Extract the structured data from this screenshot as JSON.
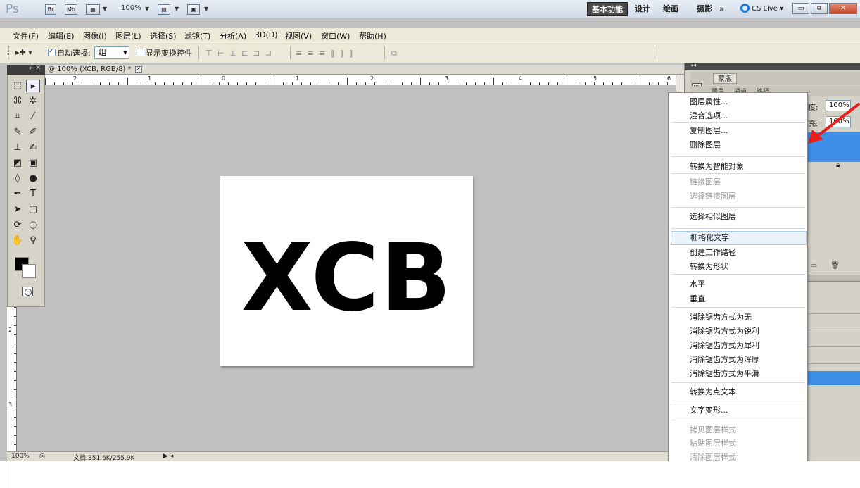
{
  "appbar": {
    "logo": "Ps",
    "bridge_label": "Br",
    "minibridge_label": "Mb",
    "zoom_value": "100%",
    "workspaces": [
      "基本功能",
      "设计",
      "绘画",
      "摄影",
      "»"
    ],
    "cslive_label": "CS Live"
  },
  "menubar": {
    "items": [
      "文件(F)",
      "编辑(E)",
      "图像(I)",
      "图层(L)",
      "选择(S)",
      "滤镜(T)",
      "分析(A)",
      "3D(D)",
      "视图(V)",
      "窗口(W)",
      "帮助(H)"
    ]
  },
  "options": {
    "auto_select_label": "自动选择:",
    "auto_select_checked": true,
    "auto_select_value": "组",
    "show_transform_label": "显示变换控件",
    "show_transform_checked": false
  },
  "document": {
    "tab_title": "@ 100% (XCB, RGB/8) *",
    "canvas_text": "XCB"
  },
  "rulers": {
    "h_labels": [
      "2",
      "1",
      "0",
      "1",
      "2",
      "3",
      "4",
      "5",
      "6"
    ],
    "v_labels": [
      "2",
      "3"
    ]
  },
  "statusbar": {
    "zoom": "100%",
    "doc_info": "文档:351.6K/255.9K"
  },
  "right_panel": {
    "tab_top": "蒙版",
    "tabs2": [
      "图层",
      "通道",
      "路径"
    ],
    "opacity_label": "明度:",
    "opacity_value": "100%",
    "fill_label": "填充:",
    "fill_value": "100%"
  },
  "context_menu": {
    "items": [
      {
        "label": "图层属性...",
        "disabled": false
      },
      {
        "label": "混合选项...",
        "disabled": false
      },
      {
        "label": "复制图层...",
        "disabled": false
      },
      {
        "label": "删除图层",
        "disabled": false
      },
      {
        "label": "转换为智能对象",
        "disabled": false
      },
      {
        "label": "链接图层",
        "disabled": true
      },
      {
        "label": "选择链接图层",
        "disabled": true
      },
      {
        "label": "选择相似图层",
        "disabled": false
      },
      {
        "label": "栅格化文字",
        "disabled": false,
        "highlighted": true
      },
      {
        "label": "创建工作路径",
        "disabled": false
      },
      {
        "label": "转换为形状",
        "disabled": false
      },
      {
        "label": "水平",
        "disabled": false
      },
      {
        "label": "垂直",
        "disabled": false
      },
      {
        "label": "消除锯齿方式为无",
        "disabled": false
      },
      {
        "label": "消除锯齿方式为锐利",
        "disabled": false
      },
      {
        "label": "消除锯齿方式为犀利",
        "disabled": false
      },
      {
        "label": "消除锯齿方式为浑厚",
        "disabled": false
      },
      {
        "label": "消除锯齿方式为平滑",
        "disabled": false
      },
      {
        "label": "转换为点文本",
        "disabled": false
      },
      {
        "label": "文字变形...",
        "disabled": false
      },
      {
        "label": "拷贝图层样式",
        "disabled": true
      },
      {
        "label": "粘贴图层样式",
        "disabled": true
      },
      {
        "label": "清除图层样式",
        "disabled": true
      }
    ]
  },
  "colors": {
    "highlight": "#eaf2fc",
    "selection_blue": "#3e8fe8",
    "annotation_arrow": "#e8201a"
  }
}
